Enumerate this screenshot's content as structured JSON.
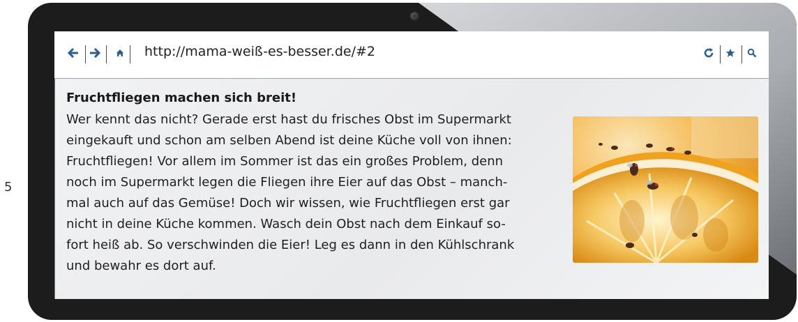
{
  "margin": {
    "line_number": "5"
  },
  "browser": {
    "url": "http://mama-weiß-es-besser.de/#2",
    "icons": {
      "back": "arrow-left-icon",
      "forward": "arrow-right-icon",
      "home": "home-icon",
      "reload": "reload-icon",
      "bookmark": "star-icon",
      "search": "search-icon"
    },
    "accent_color": "#2f5f8f"
  },
  "article": {
    "headline": "Fruchtfliegen machen sich breit!",
    "lines": [
      "Wer kennt das nicht? Gerade erst hast du frisches Obst im Supermarkt",
      "eingekauft und schon am selben Abend ist deine Küche voll von ihnen:",
      "Fruchtfliegen! Vor allem im Sommer ist das ein großes Problem, denn",
      "noch im Supermarkt legen die Fliegen ihre Eier auf das Obst – manch-",
      "mal auch auf das Gemüse! Doch wir wissen, wie Fruchtfliegen erst gar",
      "nicht in deine Küche kommen. Wasch dein Obst nach dem Einkauf so-",
      "fort heiß ab. So verschwinden die Eier! Leg es dann in den Kühlschrank",
      "und bewahr es dort auf."
    ],
    "image": "fruit-flies-on-lemon-photo"
  }
}
